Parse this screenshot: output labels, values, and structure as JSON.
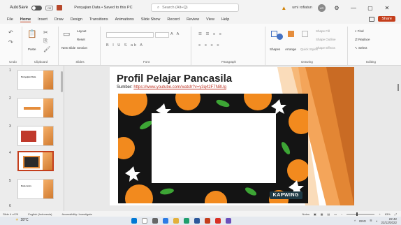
{
  "titlebar": {
    "autosave_label": "AutoSave",
    "autosave_state": "Off",
    "doc_title": "Penyajian Data • Saved to this PC",
    "search_placeholder": "Search (Alt+Q)",
    "user_name": "umi rofiatun",
    "user_initials": "UR",
    "minimize": "—",
    "maximize": "▢",
    "close": "✕"
  },
  "menu": {
    "tabs": [
      "File",
      "Home",
      "Insert",
      "Draw",
      "Design",
      "Transitions",
      "Animations",
      "Slide Show",
      "Record",
      "Review",
      "View",
      "Help"
    ],
    "active": "Home",
    "share": "Share"
  },
  "ribbon": {
    "groups": {
      "undo": "Undo",
      "clipboard": "Clipboard",
      "slides": "Slides",
      "font": "Font",
      "paragraph": "Paragraph",
      "drawing": "Drawing",
      "editing": "Editing"
    },
    "paste": "Paste",
    "new_slide": "New Slide",
    "layout": "Layout",
    "reset": "Reset",
    "section": "Section",
    "shapes": "Shapes",
    "arrange": "Arrange",
    "quick_styles": "Quick Styles",
    "shape_fill": "Shape Fill",
    "shape_outline": "Shape Outline",
    "shape_effects": "Shape Effects",
    "find": "Find",
    "replace": "Replace",
    "select": "Select",
    "font_format_row": "B  I  U  S  ab  A"
  },
  "thumbnails": [
    {
      "num": "1",
      "title": "Penyajian Data"
    },
    {
      "num": "2",
      "title": ""
    },
    {
      "num": "3",
      "title": ""
    },
    {
      "num": "4",
      "title": "Profil Pelajar Pancasila"
    },
    {
      "num": "5",
      "title": "Data Jenis"
    }
  ],
  "slide": {
    "title": "Profil Pelajar Pancasila",
    "source_label": "Sumber:",
    "source_url": "https://www.youtube.com/watch?v=y3q42F7N8Ug",
    "watermark": "KAPWING"
  },
  "status": {
    "slide_count": "Slide 4 of 29",
    "language": "English (Indonesia)",
    "accessibility": "Accessibility: Investigate",
    "notes": "Notes",
    "zoom": "63%"
  },
  "taskbar": {
    "temperature": "28°C",
    "time": "22:42",
    "date": "22/12/2022",
    "lang": "ENG"
  },
  "colors": {
    "accent": "#c43e1c",
    "orange": "#e58d3c",
    "video_bg": "#1a1a1a"
  }
}
